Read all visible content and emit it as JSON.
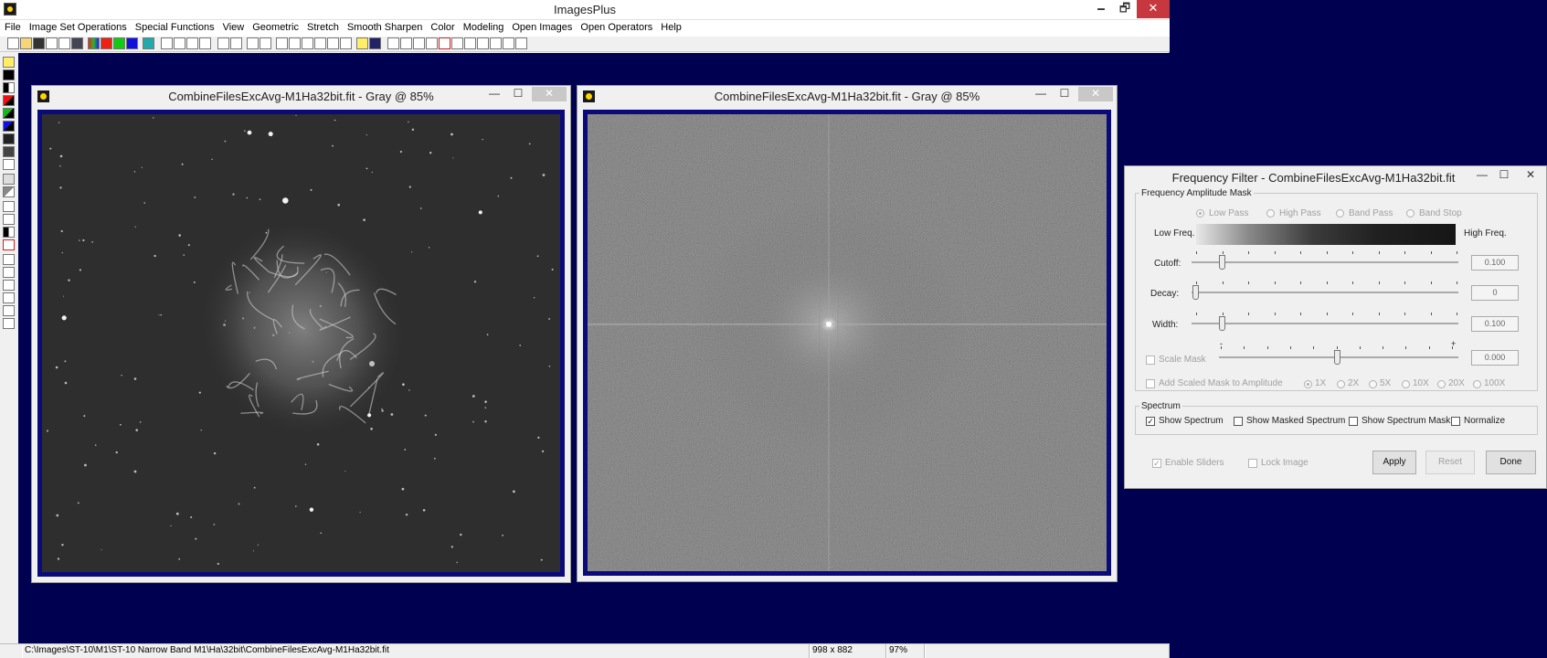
{
  "app": {
    "title": "ImagesPlus",
    "minimize": "🗕",
    "maximize": "🗗",
    "close": "✕"
  },
  "menu": [
    "File",
    "Image Set Operations",
    "Special Functions",
    "View",
    "Geometric",
    "Stretch",
    "Smooth Sharpen",
    "Color",
    "Modeling",
    "Open Images",
    "Open Operators",
    "Help"
  ],
  "windows": {
    "left": {
      "title": "CombineFilesExcAvg-M1Ha32bit.fit - Gray @ 85%",
      "min": "—",
      "max": "☐",
      "close": "✕"
    },
    "right": {
      "title": "CombineFilesExcAvg-M1Ha32bit.fit - Gray @ 85%",
      "min": "—",
      "max": "☐",
      "close": "✕"
    }
  },
  "dialog": {
    "title": "Frequency Filter - CombineFilesExcAvg-M1Ha32bit.fit",
    "min": "—",
    "max": "☐",
    "close": "✕",
    "amplitude_group": "Frequency Amplitude Mask",
    "pass_options": [
      {
        "label": "Low Pass",
        "selected": true
      },
      {
        "label": "High Pass",
        "selected": false
      },
      {
        "label": "Band Pass",
        "selected": false
      },
      {
        "label": "Band Stop",
        "selected": false
      }
    ],
    "low_freq": "Low Freq.",
    "high_freq": "High Freq.",
    "sliders": {
      "cutoff": {
        "label": "Cutoff:",
        "value": "0.100"
      },
      "decay": {
        "label": "Decay:",
        "value": "0"
      },
      "width": {
        "label": "Width:",
        "value": "0.100"
      },
      "scale_mask": {
        "label": "Scale Mask",
        "value": "0.000",
        "minus": "-",
        "plus": "+"
      }
    },
    "add_scaled_mask": "Add Scaled Mask to Amplitude",
    "scale_options": [
      {
        "label": "1X",
        "selected": true
      },
      {
        "label": "2X",
        "selected": false
      },
      {
        "label": "5X",
        "selected": false
      },
      {
        "label": "10X",
        "selected": false
      },
      {
        "label": "20X",
        "selected": false
      },
      {
        "label": "100X",
        "selected": false
      }
    ],
    "spectrum_group": "Spectrum",
    "spectrum_checks": [
      {
        "label": "Show Spectrum",
        "checked": true
      },
      {
        "label": "Show Masked Spectrum",
        "checked": false
      },
      {
        "label": "Show Spectrum Mask",
        "checked": false
      },
      {
        "label": "Normalize",
        "checked": false
      }
    ],
    "enable_sliders": "Enable Sliders",
    "lock_image": "Lock Image",
    "check_mark": "✓",
    "buttons": {
      "apply": "Apply",
      "reset": "Reset",
      "done": "Done"
    }
  },
  "status": {
    "path": "C:\\Images\\ST-10\\M1\\ST-10 Narrow Band M1\\Ha\\32bit\\CombineFilesExcAvg-M1Ha32bit.fit",
    "dimensions": "998 x 882",
    "zoom": "97%"
  }
}
